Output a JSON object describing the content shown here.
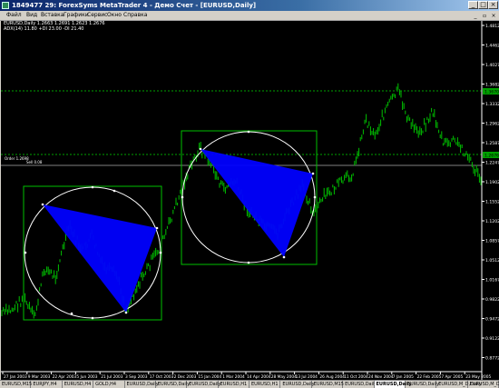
{
  "window": {
    "title": "1849477 29: ForexSyms MetaTrader 4 - Демо Счет - [EURUSD,Daily]",
    "controls": [
      "_",
      "□",
      "×"
    ]
  },
  "menu": {
    "items": [
      "Файл",
      "Вид",
      "Вставка",
      "Графики",
      "Сервис",
      "Окно",
      "Справка"
    ],
    "controls": [
      "_",
      "▫",
      "×"
    ]
  },
  "chart": {
    "symbol_line": "EURUSD,Daily  1.2663 1.2691 1.2623 1.2676",
    "indicator_line": "ADX(14) 11.80  +DI 23.00  -DI 21.40",
    "line_labels": [
      "Order 1.2698",
      "Sell 0.08"
    ],
    "price_axis": [
      "1.4812",
      "1.4462",
      "1.4027",
      "1.3682",
      "1.3332",
      "1.2962",
      "1.2587",
      "1.2247",
      "1.1902",
      "1.1552",
      "1.1202",
      "1.0857",
      "1.0512",
      "1.0167",
      "0.9822",
      "0.9472",
      "0.9122",
      "0.8772"
    ],
    "bid_label": "1.2676",
    "upper_level_label": "1.3670",
    "time_axis": [
      "27 Jan 2003",
      "9 Mar 2003",
      "22 Apr 2003",
      "5 Jun 2003",
      "21 Jul 2003",
      "3 Sep 2003",
      "17 Oct 2003",
      "2 Dec 2003",
      "15 Jan 2004",
      "1 Mar 2004",
      "14 Apr 2004",
      "28 May 2004",
      "13 Jul 2004",
      "26 Aug 2004",
      "11 Oct 2004",
      "24 Nov 2004",
      "7 Jan 2005",
      "22 Feb 2005",
      "7 Apr 2005",
      "23 May 2005"
    ],
    "colors": {
      "background": "#000000",
      "candles": "#00c000",
      "triangle": "#0000ff",
      "rectangle": "#00c000",
      "ellipse": "#ffffff",
      "level_line": "#808080",
      "axis_text": "#ffffff"
    }
  },
  "tabs": {
    "items": [
      "EURUSD,M15",
      "EURJPY,H4",
      "EURUSD,H4",
      "GOLD,H4",
      "EURUSD,Daily",
      "EURUSD,Daily",
      "EURUSD,Daily",
      "EURUSD,H1",
      "EURUSD,H1",
      "EURUSD,Daily",
      "EURUSD,M15",
      "EURUSD,Daily",
      "EURUSD,Daily",
      "EURUSD,Daily",
      "EURUSD,M_D,Daily",
      "EURUSD,M_D,Daily (offline)"
    ],
    "active_index": 12
  }
}
